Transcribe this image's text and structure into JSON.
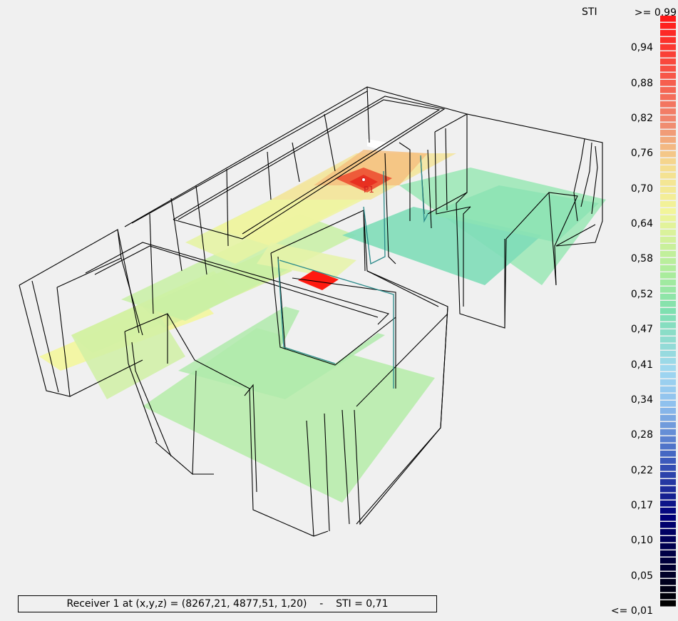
{
  "legend": {
    "title": "STI",
    "labels": [
      ">= 0,99",
      "0,94",
      "0,88",
      "0,82",
      "0,76",
      "0,70",
      "0,64",
      "0,58",
      "0,52",
      "0,47",
      "0,41",
      "0,34",
      "0,28",
      "0,22",
      "0,17",
      "0,10",
      "0,05",
      "<= 0,01"
    ],
    "colors": {
      "high": "#ff1a1a",
      "mid_high": "#f5dc90",
      "mid": "#f2f59a",
      "mid_low": "#7ee0b0",
      "low_blue": "#8fc0ee",
      "deep_blue": "#00007a",
      "black": "#000000"
    }
  },
  "receiver": {
    "label": "P1"
  },
  "status_bar": {
    "text": "Receiver 1 at (x,y,z) = (8267,21, 4877,51, 1,20)    -    STI = 0,71"
  }
}
